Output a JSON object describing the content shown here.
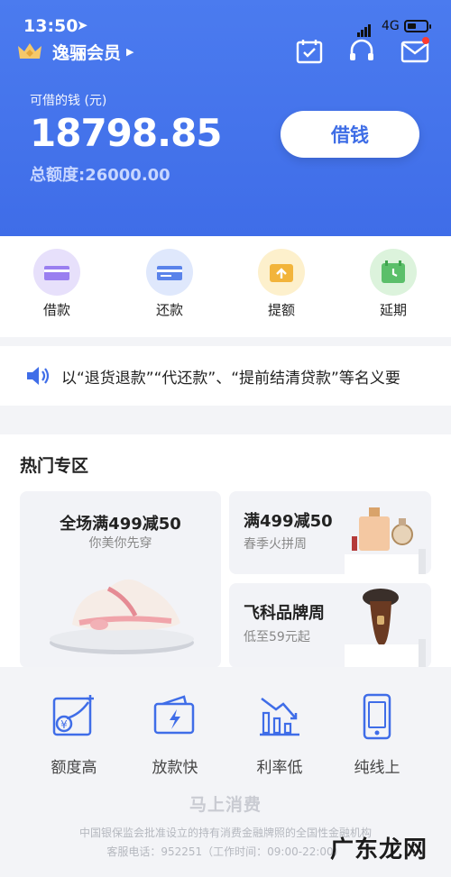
{
  "status_bar": {
    "time": "13:50",
    "network": "4G"
  },
  "header": {
    "member_label": "逸骊会员",
    "available_label": "可借的钱 (元)",
    "available_amount": "18798.85",
    "total_quota": "总额度:26000.00",
    "borrow_button": "借钱",
    "icons": [
      "calendar-check-icon",
      "headset-icon",
      "mail-icon"
    ],
    "accent_color": "#3f6de8"
  },
  "quick_actions": [
    {
      "label": "借款",
      "icon": "card-icon"
    },
    {
      "label": "还款",
      "icon": "card-repay-icon"
    },
    {
      "label": "提额",
      "icon": "wallet-up-icon"
    },
    {
      "label": "延期",
      "icon": "calendar-icon"
    }
  ],
  "notice": {
    "text": "以“退货退款”“代还款”、“提前结清贷款”等名义要"
  },
  "hot_zone": {
    "title": "热门专区",
    "cards": [
      {
        "title": "全场满499减50",
        "subtitle": "你美你先穿"
      },
      {
        "title": "满499减50",
        "subtitle": "春季火拼周"
      },
      {
        "title": "飞科品牌周",
        "subtitle": "低至59元起"
      }
    ]
  },
  "features": [
    {
      "label": "额度高",
      "icon": "chart-up-icon"
    },
    {
      "label": "放款快",
      "icon": "wallet-bolt-icon"
    },
    {
      "label": "利率低",
      "icon": "chart-down-icon"
    },
    {
      "label": "纯线上",
      "icon": "phone-icon"
    }
  ],
  "footer": {
    "brand": "马上消费",
    "line1": "中国银保监会批准设立的持有消费金融牌照的全国性金融机构",
    "line2": "客服电话：952251（工作时间：09:00-22:00）"
  },
  "watermark": "广东龙网"
}
